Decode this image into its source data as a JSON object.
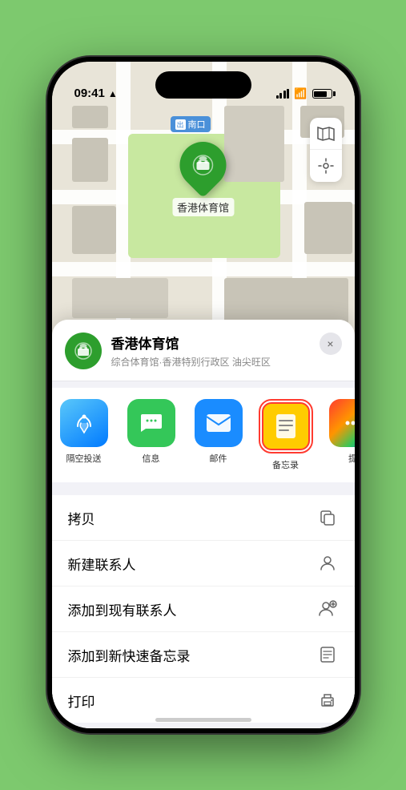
{
  "status_bar": {
    "time": "09:41",
    "location_arrow": "▶"
  },
  "map": {
    "venue_name": "香港体育馆",
    "nankou_label": "南口"
  },
  "venue_card": {
    "title": "香港体育馆",
    "subtitle": "综合体育馆·香港特别行政区 油尖旺区",
    "close_label": "×"
  },
  "share_actions": [
    {
      "id": "airdrop",
      "label": "隔空投送",
      "type": "airdrop"
    },
    {
      "id": "messages",
      "label": "信息",
      "type": "messages"
    },
    {
      "id": "mail",
      "label": "邮件",
      "type": "mail"
    },
    {
      "id": "notes",
      "label": "备忘录",
      "type": "notes"
    },
    {
      "id": "more",
      "label": "提",
      "type": "more"
    }
  ],
  "action_items": [
    {
      "id": "copy",
      "label": "拷贝",
      "icon": "copy"
    },
    {
      "id": "new-contact",
      "label": "新建联系人",
      "icon": "person"
    },
    {
      "id": "add-contact",
      "label": "添加到现有联系人",
      "icon": "person-add"
    },
    {
      "id": "add-notes",
      "label": "添加到新快速备忘录",
      "icon": "notes"
    },
    {
      "id": "print",
      "label": "打印",
      "icon": "print"
    }
  ],
  "icons": {
    "map_view": "🗺",
    "location": "⊙",
    "copy_icon": "⊕",
    "person_icon": "👤",
    "person_add_icon": "👤+",
    "notes_icon": "📋",
    "print_icon": "🖨"
  }
}
